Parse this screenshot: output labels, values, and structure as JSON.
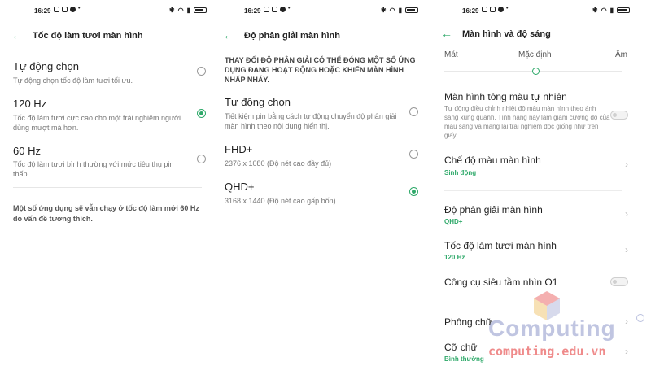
{
  "status": {
    "time": "16:29"
  },
  "screen1": {
    "title": "Tốc độ làm tươi màn hình",
    "options": [
      {
        "title": "Tự động chọn",
        "desc": "Tự động chọn tốc độ làm tươi tối ưu.",
        "selected": false
      },
      {
        "title": "120 Hz",
        "desc": "Tốc độ làm tươi cực cao cho một trải nghiệm người dùng mượt mà hơn.",
        "selected": true
      },
      {
        "title": "60 Hz",
        "desc": "Tốc độ làm tươi bình thường với mức tiêu thụ pin thấp.",
        "selected": false
      }
    ],
    "note": "Một số ứng dụng sẽ vẫn chạy ở tốc độ làm mới 60 Hz do vấn đề tương thích."
  },
  "screen2": {
    "title": "Độ phân giải màn hình",
    "warning": "THAY ĐỔI ĐỘ PHÂN GIẢI CÓ THỂ ĐÓNG MỘT SỐ ỨNG DỤNG ĐANG HOẠT ĐỘNG HOẶC KHIẾN MÀN HÌNH NHẤP NHÁY.",
    "options": [
      {
        "title": "Tự động chọn",
        "desc": "Tiết kiệm pin bằng cách tự động chuyển độ phân giải màn hình theo nội dung hiển thị.",
        "selected": false
      },
      {
        "title": "FHD+",
        "desc": "2376 x 1080 (Độ nét cao đầy đủ)",
        "selected": false
      },
      {
        "title": "QHD+",
        "desc": "3168 x 1440 (Độ nét cao gấp bốn)",
        "selected": true
      }
    ]
  },
  "screen3": {
    "title": "Màn hình và độ sáng",
    "slider": {
      "left": "Mát",
      "middle": "Mặc định",
      "right": "Ấm"
    },
    "natural_tone": {
      "title": "Màn hình tông màu tự nhiên",
      "desc": "Tự động điều chỉnh nhiệt độ màu màn hình theo ánh sáng xung quanh. Tính năng này làm giảm cường độ của màu sáng và mang lại trải nghiệm đọc giống như trên giấy."
    },
    "color_mode": {
      "title": "Chế độ màu màn hình",
      "value": "Sinh động"
    },
    "resolution": {
      "title": "Độ phân giải màn hình",
      "value": "QHD+"
    },
    "refresh": {
      "title": "Tốc độ làm tươi màn hình",
      "value": "120 Hz"
    },
    "o1": {
      "title": "Công cụ siêu tầm nhìn O1"
    },
    "font": {
      "title": "Phông chữ"
    },
    "font_size": {
      "title": "Cỡ chữ",
      "value": "Bình thường"
    }
  },
  "watermark": {
    "brand": "Computing",
    "url": "computing.edu.vn"
  },
  "colors": {
    "accent": "#2fa96a"
  }
}
